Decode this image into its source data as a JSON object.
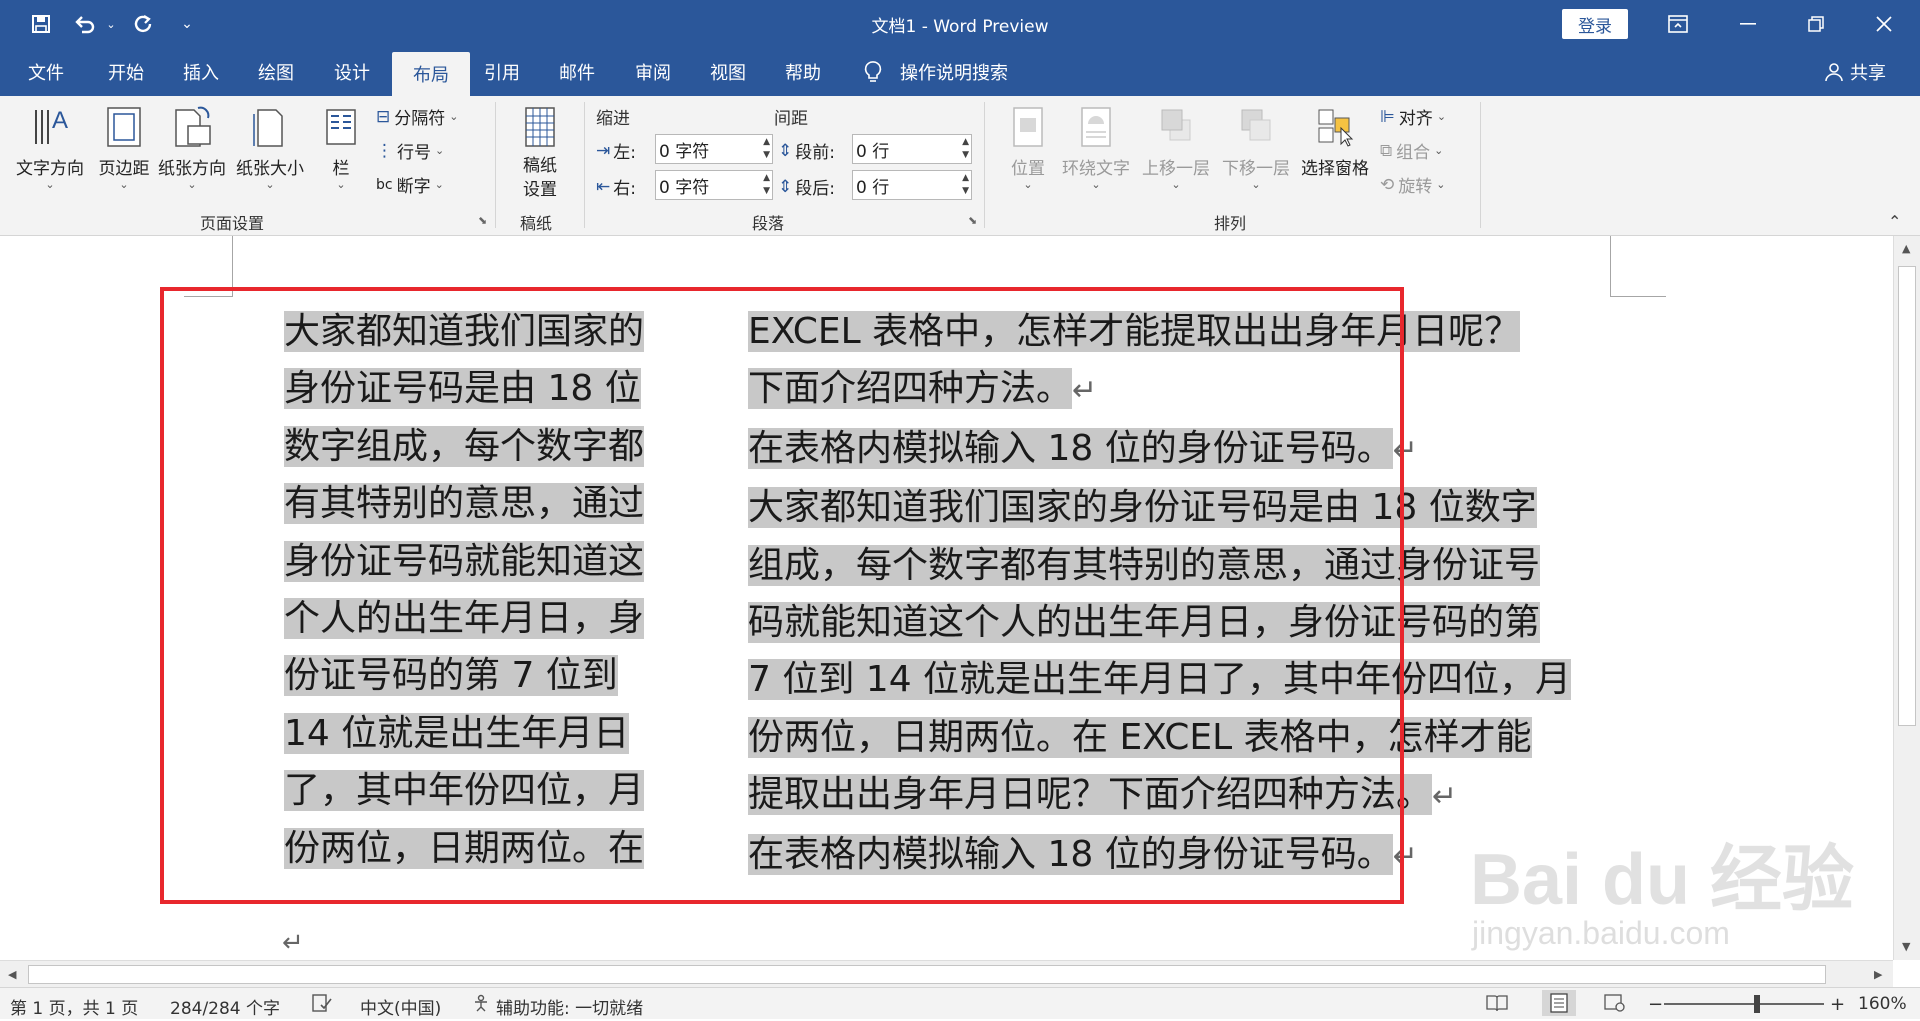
{
  "window": {
    "title": "文档1  -  Word Preview",
    "login": "登录"
  },
  "quick_access": {
    "save_icon": "save-icon",
    "undo_icon": "undo-icon",
    "redo_icon": "redo-icon",
    "customize_icon": "customize-qat-icon"
  },
  "tabs": [
    "文件",
    "开始",
    "插入",
    "绘图",
    "设计",
    "布局",
    "引用",
    "邮件",
    "审阅",
    "视图",
    "帮助"
  ],
  "active_tab": "布局",
  "tell_me": "操作说明搜索",
  "share": "共享",
  "ribbon": {
    "page_setup": {
      "label": "页面设置",
      "text_direction": "文字方向",
      "margins": "页边距",
      "orientation": "纸张方向",
      "size": "纸张大小",
      "columns": "栏",
      "breaks": "分隔符",
      "line_numbers": "行号",
      "hyphenation": "断字"
    },
    "manuscript": {
      "label": "稿纸",
      "button": "稿纸\n设置"
    },
    "paragraph": {
      "label": "段落",
      "indent_head": "缩进",
      "spacing_head": "间距",
      "left_label": "左:",
      "left_value": "0 字符",
      "right_label": "右:",
      "right_value": "0 字符",
      "before_label": "段前:",
      "before_value": "0 行",
      "after_label": "段后:",
      "after_value": "0 行"
    },
    "arrange": {
      "label": "排列",
      "position": "位置",
      "wrap_text": "环绕文字",
      "bring_forward": "上移一层",
      "send_backward": "下移一层",
      "selection_pane": "选择窗格",
      "align": "对齐",
      "group": "组合",
      "rotate": "旋转"
    }
  },
  "document": {
    "col1_lines": [
      "大家都知道我们国家的",
      "身份证号码是由 18 位",
      "数字组成，每个数字都",
      "有其特别的意思，通过",
      "身份证号码就能知道这",
      "个人的出生年月日，身",
      "份证号码的第 7 位到",
      "14 位就是出生年月日",
      "了，其中年份四位，月",
      "份两位，日期两位。在"
    ],
    "col2_lines": [
      "EXCEL 表格中，怎样才能提取出出身年月日呢？",
      "下面介绍四种方法。",
      "在表格内模拟输入 18 位的身份证号码。",
      "大家都知道我们国家的身份证号码是由 18 位数字",
      "组成，每个数字都有其特别的意思，通过身份证号",
      "码就能知道这个人的出生年月日，身份证号码的第",
      "7 位到 14 位就是出生年月日了，其中年份四位，月",
      "份两位，日期两位。在 EXCEL 表格中，怎样才能",
      "提取出出身年月日呢？下面介绍四种方法。",
      "在表格内模拟输入 18 位的身份证号码。"
    ],
    "pilcrow": "↵",
    "watermark": "Bai du 经验",
    "watermark_url": "jingyan.baidu.com"
  },
  "status": {
    "page": "第 1 页，共 1 页",
    "words": "284/284 个字",
    "language": "中文(中国)",
    "accessibility": "辅助功能: 一切就绪",
    "zoom": "160%",
    "zoom_minus": "−",
    "zoom_plus": "+"
  }
}
